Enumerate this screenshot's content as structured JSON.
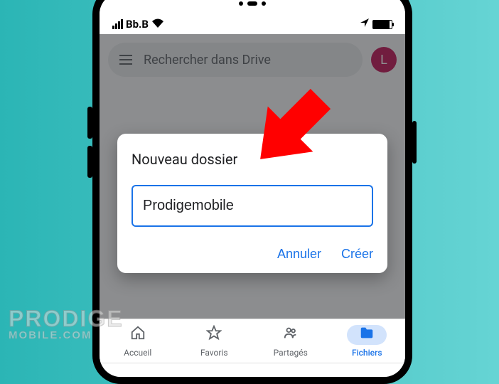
{
  "statusbar": {
    "carrier": "Bb.B"
  },
  "search": {
    "placeholder": "Rechercher dans Drive"
  },
  "avatar": {
    "letter": "L"
  },
  "dialog": {
    "title": "Nouveau dossier",
    "input_value": "Prodigemobile",
    "cancel": "Annuler",
    "create": "Créer"
  },
  "nav": {
    "home": "Accueil",
    "starred": "Favoris",
    "shared": "Partagés",
    "files": "Fichiers"
  },
  "watermark": {
    "main": "PRODIGE",
    "sub": "MOBILE.COM"
  }
}
